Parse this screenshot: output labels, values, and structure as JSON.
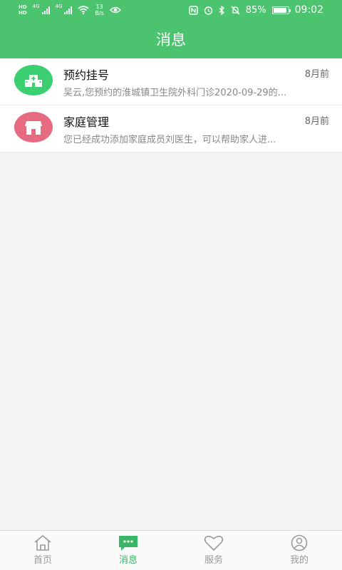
{
  "status_bar": {
    "hd_label": "HD",
    "network_label": "4G",
    "net_speed_value": "13",
    "net_speed_unit": "B/s",
    "battery_percent": "85%",
    "time": "09:02"
  },
  "header": {
    "title": "消息"
  },
  "messages": [
    {
      "title": "预约挂号",
      "time": "8月前",
      "preview": "吴云,您预约的淮城镇卫生院外科门诊2020-09-29的...",
      "icon": "hospital-icon",
      "color": "#3ccf72"
    },
    {
      "title": "家庭管理",
      "time": "8月前",
      "preview": "您已经成功添加家庭成员刘医生，可以帮助家人进...",
      "icon": "house-icon",
      "color": "#e66b80"
    }
  ],
  "tabs": [
    {
      "label": "首页",
      "icon": "home-icon"
    },
    {
      "label": "消息",
      "icon": "message-icon",
      "active": true
    },
    {
      "label": "服务",
      "icon": "heart-icon"
    },
    {
      "label": "我的",
      "icon": "user-icon"
    }
  ],
  "colors": {
    "primary": "#4cc36f",
    "tab_active": "#3ab565",
    "tab_inactive": "#999999"
  }
}
